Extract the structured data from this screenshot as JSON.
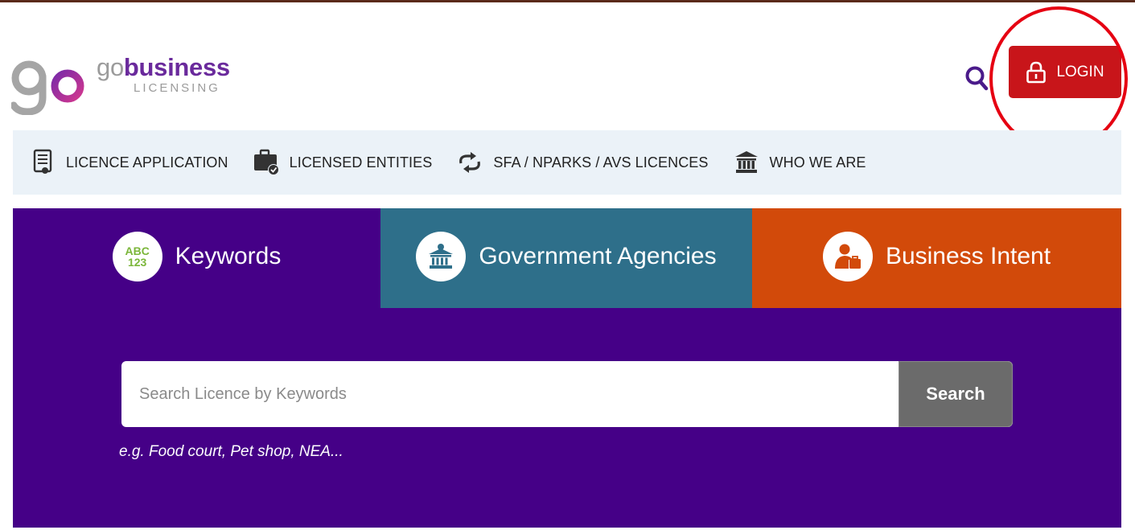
{
  "header": {
    "logo_prefix": "go",
    "logo_main": "business",
    "logo_sub": "LICENSING",
    "login_label": "LOGIN"
  },
  "nav": {
    "items": [
      {
        "label": "LICENCE APPLICATION",
        "icon": "document-icon"
      },
      {
        "label": "LICENSED ENTITIES",
        "icon": "briefcase-check-icon"
      },
      {
        "label": "SFA / NPARKS / AVS LICENCES",
        "icon": "exchange-arrows-icon"
      },
      {
        "label": "WHO WE ARE",
        "icon": "institution-icon"
      }
    ]
  },
  "hero": {
    "tabs": [
      {
        "label": "Keywords",
        "icon_text_top": "ABC",
        "icon_text_bottom": "123",
        "color": "#450087"
      },
      {
        "label": "Government Agencies",
        "icon": "government-building-icon",
        "color": "#2e6f8a"
      },
      {
        "label": "Business Intent",
        "icon": "person-briefcase-icon",
        "color": "#d24a0a"
      }
    ],
    "search": {
      "placeholder": "Search Licence by Keywords",
      "button_label": "Search"
    },
    "hint": "e.g. Food court, Pet shop, NEA..."
  },
  "colors": {
    "brand_purple": "#450087",
    "login_red": "#c8151a",
    "annotation_red": "#e60012"
  }
}
